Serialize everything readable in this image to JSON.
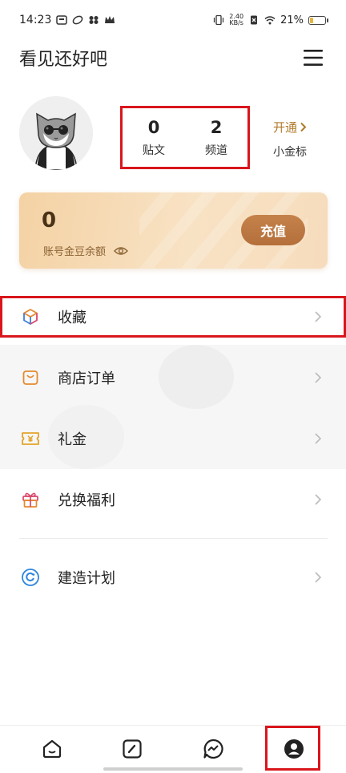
{
  "status_bar": {
    "time": "14:23",
    "net_speed_value": "2.40",
    "net_speed_unit": "KB/s",
    "battery_percent": "21%",
    "battery_level": 0.21,
    "battery_color": "#e6b53a"
  },
  "header": {
    "title": "看见还好吧",
    "menu_icon": "hamburger-menu-icon"
  },
  "profile": {
    "avatar_icon": "cat-with-sunglasses-avatar",
    "stats": [
      {
        "value": "0",
        "label": "贴文"
      },
      {
        "value": "2",
        "label": "频道"
      }
    ],
    "vip_link": "开通",
    "vip_sub": "小金标"
  },
  "balance": {
    "value": "0",
    "label": "账号金豆余额",
    "eye_icon": "eye-icon",
    "recharge_label": "充值"
  },
  "menu": [
    {
      "label": "收藏",
      "icon": "cube-icon"
    },
    {
      "label": "商店订单",
      "icon": "shopping-bag-icon"
    },
    {
      "label": "礼金",
      "icon": "yen-ticket-icon"
    },
    {
      "label": "兑换福利",
      "icon": "gift-icon"
    },
    {
      "label": "建造计划",
      "icon": "circular-progress-icon"
    }
  ],
  "bottom_nav": [
    {
      "icon": "home-icon"
    },
    {
      "icon": "compose-icon"
    },
    {
      "icon": "message-icon"
    },
    {
      "icon": "profile-icon"
    }
  ],
  "colors": {
    "highlight_border": "#d9161c",
    "accent_gold": "#b07a2a",
    "recharge_button": "#b46f3a",
    "menu_icon_orange": "#e58a2e"
  }
}
